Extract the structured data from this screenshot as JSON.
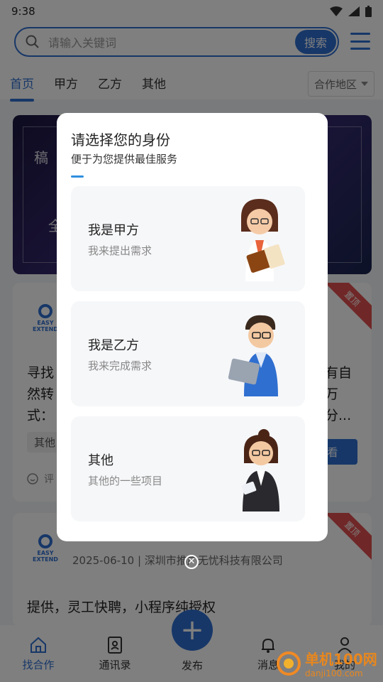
{
  "status": {
    "time": "9:38"
  },
  "search": {
    "placeholder": "请输入关键词",
    "button": "搜索"
  },
  "tabs": [
    {
      "label": "首页",
      "active": true
    },
    {
      "label": "甲方"
    },
    {
      "label": "乙方"
    },
    {
      "label": "其他"
    }
  ],
  "region": {
    "label": "合作地区"
  },
  "banner": {
    "text1": "稿",
    "text2": "全"
  },
  "card1": {
    "badge": "置顶",
    "logo_text": "EASY EXTEND",
    "body_lines": [
      "寻找",
      "然转",
      "式："
    ],
    "body_right": [
      "有自",
      "万",
      "分..."
    ],
    "chip": "其他",
    "view": "看",
    "comment": "评"
  },
  "card2": {
    "badge": "置顶",
    "meta": "2025-06-10 | 深圳市推广无忧科技有限公司",
    "body": "提供，灵工快聘，小程序纯授权"
  },
  "dialog": {
    "title": "请选择您的身份",
    "subtitle": "便于为您提供最佳服务",
    "options": [
      {
        "title": "我是甲方",
        "desc": "我来提出需求",
        "icon": "woman-reading-book"
      },
      {
        "title": "我是乙方",
        "desc": "我来完成需求",
        "icon": "man-with-laptop"
      },
      {
        "title": "其他",
        "desc": "其他的一些项目",
        "icon": "woman-holding-phone"
      }
    ]
  },
  "bottom_nav": [
    {
      "label": "找合作",
      "icon": "home-icon",
      "active": true
    },
    {
      "label": "通讯录",
      "icon": "contacts-icon"
    },
    {
      "label": "发布",
      "icon": "plus-icon"
    },
    {
      "label": "消息",
      "icon": "bell-icon"
    },
    {
      "label": "我的",
      "icon": "user-icon"
    }
  ],
  "watermark": {
    "title": "单机100网",
    "url": "danji100.com"
  },
  "colors": {
    "accent": "#2f6fd0",
    "badge": "#e04e4e"
  }
}
